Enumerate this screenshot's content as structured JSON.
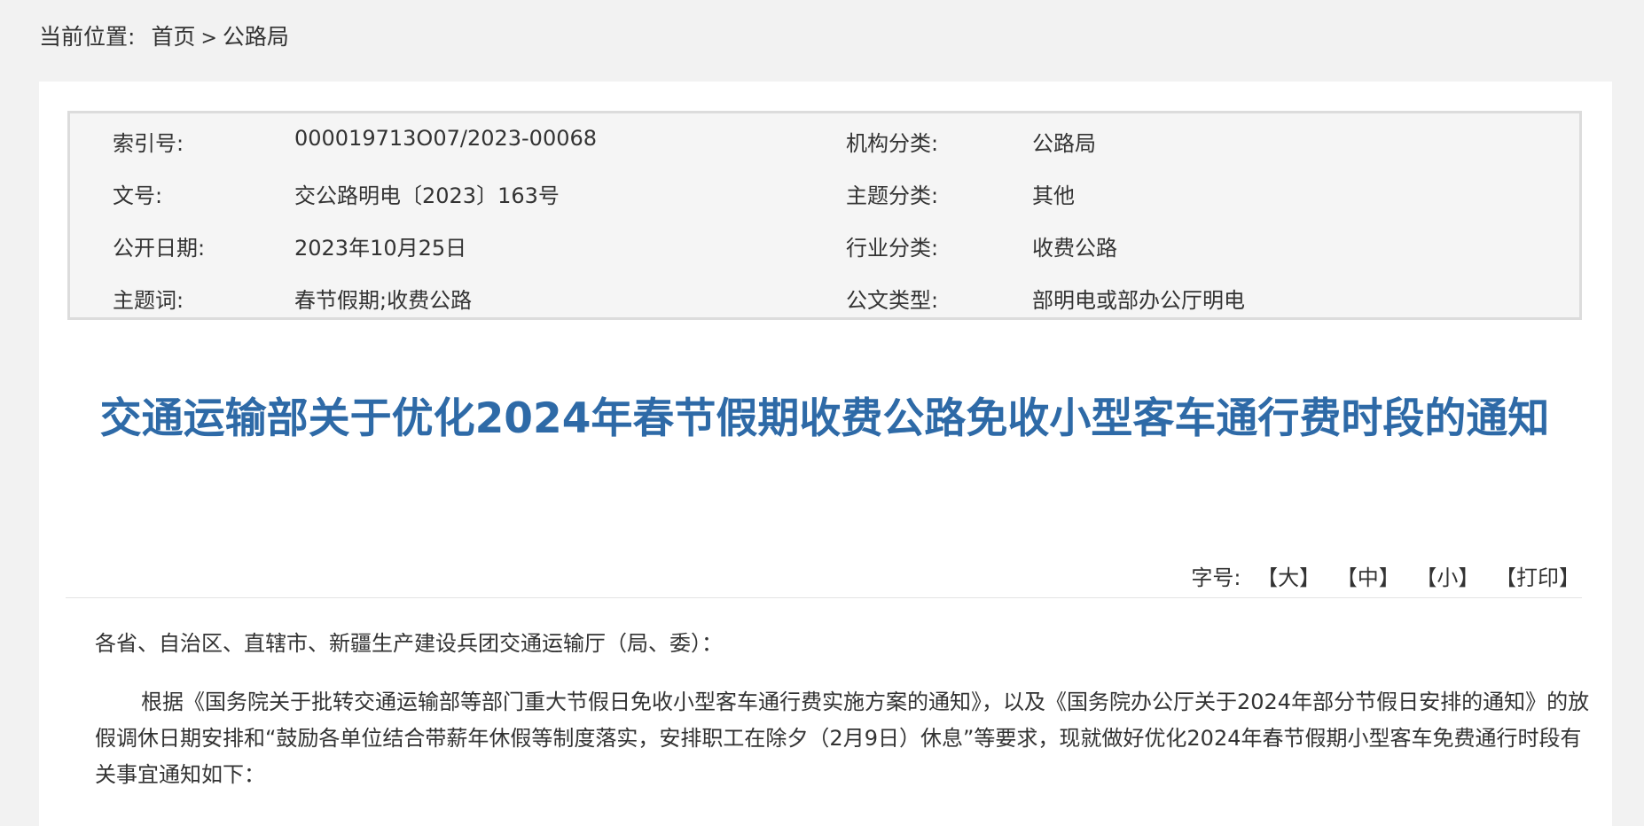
{
  "breadcrumb": {
    "prefix": "当前位置:",
    "home": "首页",
    "separator": ">",
    "current": "公路局"
  },
  "meta": {
    "index_label": "索引号:",
    "index_value": "000019713O07/2023-00068",
    "org_label": "机构分类:",
    "org_value": "公路局",
    "docno_label": "文号:",
    "docno_value": "交公路明电〔2023〕163号",
    "topic_label": "主题分类:",
    "topic_value": "其他",
    "date_label": "公开日期:",
    "date_value": "2023年10月25日",
    "industry_label": "行业分类:",
    "industry_value": "收费公路",
    "keywords_label": "主题词:",
    "keywords_value": "春节假期;收费公路",
    "doctype_label": "公文类型:",
    "doctype_value": "部明电或部办公厅明电"
  },
  "title": "交通运输部关于优化2024年春节假期收费公路免收小型客车通行费时段的通知",
  "font_controls": {
    "label": "字号:",
    "large": "【大】",
    "medium": "【中】",
    "small": "【小】",
    "print": "【打印】"
  },
  "content": {
    "salutation": "各省、自治区、直辖市、新疆生产建设兵团交通运输厅（局、委）：",
    "paragraph": "根据《国务院关于批转交通运输部等部门重大节假日免收小型客车通行费实施方案的通知》，以及《国务院办公厅关于2024年部分节假日安排的通知》的放假调休日期安排和“鼓励各单位结合带薪年休假等制度落实，安排职工在除夕（2月9日）休息”等要求，现就做好优化2024年春节假期小型客车免费通行时段有关事宜通知如下："
  },
  "colors": {
    "title": "#2e6aa7",
    "background": "#f2f2f2",
    "meta_background": "#f5f5f5"
  }
}
